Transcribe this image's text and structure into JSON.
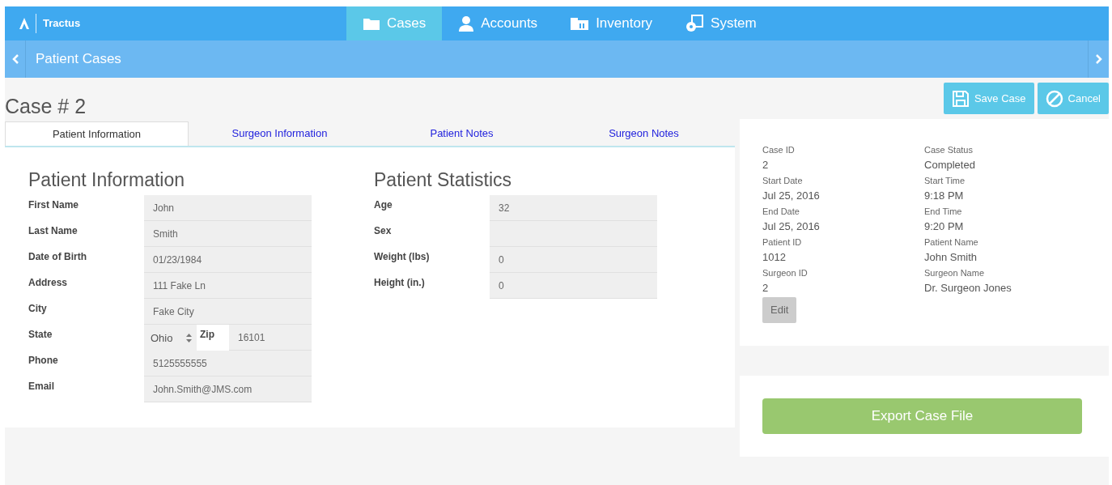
{
  "navbar": {
    "brand": "Tractus",
    "items": [
      {
        "label": "Cases",
        "kind": "folder",
        "selected": true
      },
      {
        "label": "Accounts",
        "kind": "person",
        "selected": false
      },
      {
        "label": "Inventory",
        "kind": "inventory",
        "selected": false
      },
      {
        "label": "System",
        "kind": "system",
        "selected": false
      }
    ]
  },
  "subbar": {
    "title": "Patient Cases"
  },
  "case_title": "Case # 2",
  "actions": [
    {
      "label": "Save Case",
      "kind": "save"
    },
    {
      "label": "Cancel",
      "kind": "cancel"
    }
  ],
  "tabs": [
    {
      "label": "Patient Information",
      "selected": true
    },
    {
      "label": "Surgeon Information",
      "selected": false
    },
    {
      "label": "Patient Notes",
      "selected": false
    },
    {
      "label": "Surgeon Notes",
      "selected": false
    }
  ],
  "patient_information": {
    "title": "Patient Information",
    "fields": [
      {
        "kind": "text",
        "label": "First Name",
        "value": "John"
      },
      {
        "kind": "text",
        "label": "Last Name",
        "value": "Smith"
      },
      {
        "kind": "text",
        "label": "Date of Birth",
        "value": "01/23/1984"
      },
      {
        "kind": "text",
        "label": "Address",
        "value": "111 Fake Ln"
      },
      {
        "kind": "text",
        "label": "City",
        "value": "Fake City"
      },
      {
        "kind": "state_zip",
        "label": "State",
        "value": "Ohio",
        "zip_label": "Zip",
        "zip_value": "16101"
      },
      {
        "kind": "text",
        "label": "Phone",
        "value": "5125555555"
      },
      {
        "kind": "text",
        "label": "Email",
        "value": "John.Smith@JMS.com"
      }
    ]
  },
  "patient_statistics": {
    "title": "Patient Statistics",
    "fields": [
      {
        "kind": "text",
        "label": "Age",
        "value": "32"
      },
      {
        "kind": "text",
        "label": "Sex"
      },
      {
        "kind": "text",
        "label": "Weight (lbs)",
        "value": "0"
      },
      {
        "kind": "text",
        "label": "Height (in.)",
        "value": "0"
      }
    ]
  },
  "summary": {
    "items": [
      {
        "label": "Case ID",
        "value": "2"
      },
      {
        "label": "Case Status",
        "value": "Completed"
      },
      {
        "label": "Start Date",
        "value": "Jul 25, 2016"
      },
      {
        "label": "Start Time",
        "value": "9:18 PM"
      },
      {
        "label": "End Date",
        "value": "Jul 25, 2016"
      },
      {
        "label": "End Time",
        "value": "9:20 PM"
      },
      {
        "label": "Patient ID",
        "value": "1012"
      },
      {
        "label": "Patient Name",
        "value": "John Smith"
      },
      {
        "label": "Surgeon ID",
        "value": "2"
      },
      {
        "label": "Surgeon Name",
        "value": "Dr. Surgeon Jones"
      }
    ],
    "edit_button": "Edit"
  },
  "export_button": "Export Case File"
}
